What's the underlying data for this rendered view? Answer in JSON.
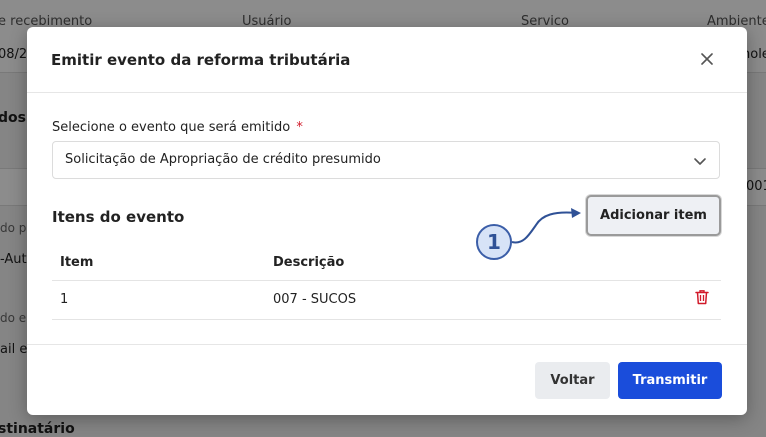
{
  "background": {
    "columns": [
      "e recebimento",
      "Usuário",
      "Servico",
      "Ambiente"
    ],
    "row1": [
      "08/2",
      "hole"
    ],
    "section1": "dos",
    "value_right": "001",
    "label1": "do p",
    "value1": "-Aut",
    "label2": "do e",
    "value2": "ail e",
    "section2": "stinatário"
  },
  "modal": {
    "title": "Emitir evento da reforma tributária",
    "select_label": "Selecione o evento que será emitido",
    "required_mark": "*",
    "selected_event": "Solicitação de Apropriação de crédito presumido",
    "items_title": "Itens do evento",
    "add_item_label": "Adicionar item",
    "step_badge": "1",
    "table": {
      "headers": [
        "Item",
        "Descrição"
      ],
      "rows": [
        {
          "item": "1",
          "descricao": "007 - SUCOS"
        }
      ]
    },
    "back_label": "Voltar",
    "transmit_label": "Transmitir"
  },
  "colors": {
    "primary": "#1a4ddb",
    "danger": "#d11a2a",
    "badge_border": "#3b5ea8"
  },
  "icons": [
    "close-icon",
    "chevron-down-icon",
    "trash-icon",
    "arrow-annotation"
  ]
}
